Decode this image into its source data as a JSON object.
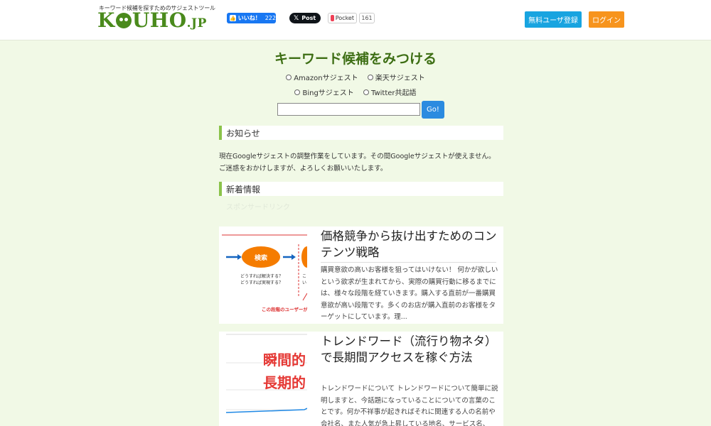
{
  "header": {
    "logo_tagline": "キーワード候補を探すためのサジェストツール",
    "logo_text_pre": "K",
    "logo_text_post": "UHO",
    "logo_suffix": ".JP",
    "fb_like_label": "いいね！",
    "fb_like_count": "222",
    "x_post_label": "Post",
    "pocket_label": "Pocket",
    "pocket_count": "161",
    "register_label": "無料ユーザ登録",
    "login_label": "ログイン"
  },
  "search": {
    "title": "キーワード候補をみつける",
    "options_row1": [
      "Amazonサジェスト",
      "楽天サジェスト"
    ],
    "options_row2": [
      "Bingサジェスト",
      "Twitter共起語"
    ],
    "input_value": "",
    "go_label": "Go!"
  },
  "notice": {
    "heading": "お知らせ",
    "line1": "現在Googleサジェストの調整作業をしています。その間Googleサジェストが使えません。",
    "line2": "ご迷惑をおかけしますが、よろしくお願いいたします。"
  },
  "news": {
    "heading": "新着情報",
    "sponsor_label": "スポンサードリンク"
  },
  "articles": [
    {
      "title": "価格競争から抜け出すためのコンテンツ戦略",
      "excerpt": "購買意欲の高いお客様を狙ってはいけない！ 何かが欲しいという欲求が生まれてから、実際の購買行動に移るまでには、様々な段階を経ていきます。購入する直前が一番購買意欲が高い段階です。多くのお店が購入直前のお客様をターゲットにしています。理...",
      "thumb": {
        "node_label": "検索",
        "question1": "どうすれば解決する？",
        "question2": "どうすれば実現する？",
        "partial_text": "こ",
        "partial_text2": "い",
        "caption": "この段階のユーザーが"
      }
    },
    {
      "title": "トレンドワード（流行り物ネタ）で長期間アクセスを稼ぐ方法",
      "excerpt": "トレンドワードについて トレンドワードについて簡単に説明しますと、今話題になっていることについての言葉のことです。何か不祥事が起きればそれに関連する人の名前や会社名、また人気が急上昇している地名、サービス名、",
      "thumb": {
        "text1": "瞬間的",
        "text2": "長期的"
      }
    }
  ],
  "colors": {
    "brand_green": "#4a8a1c",
    "register_blue": "#18a4e0",
    "login_orange": "#f7941d",
    "go_blue": "#2b8be0",
    "accent_green": "#8bc34a"
  }
}
